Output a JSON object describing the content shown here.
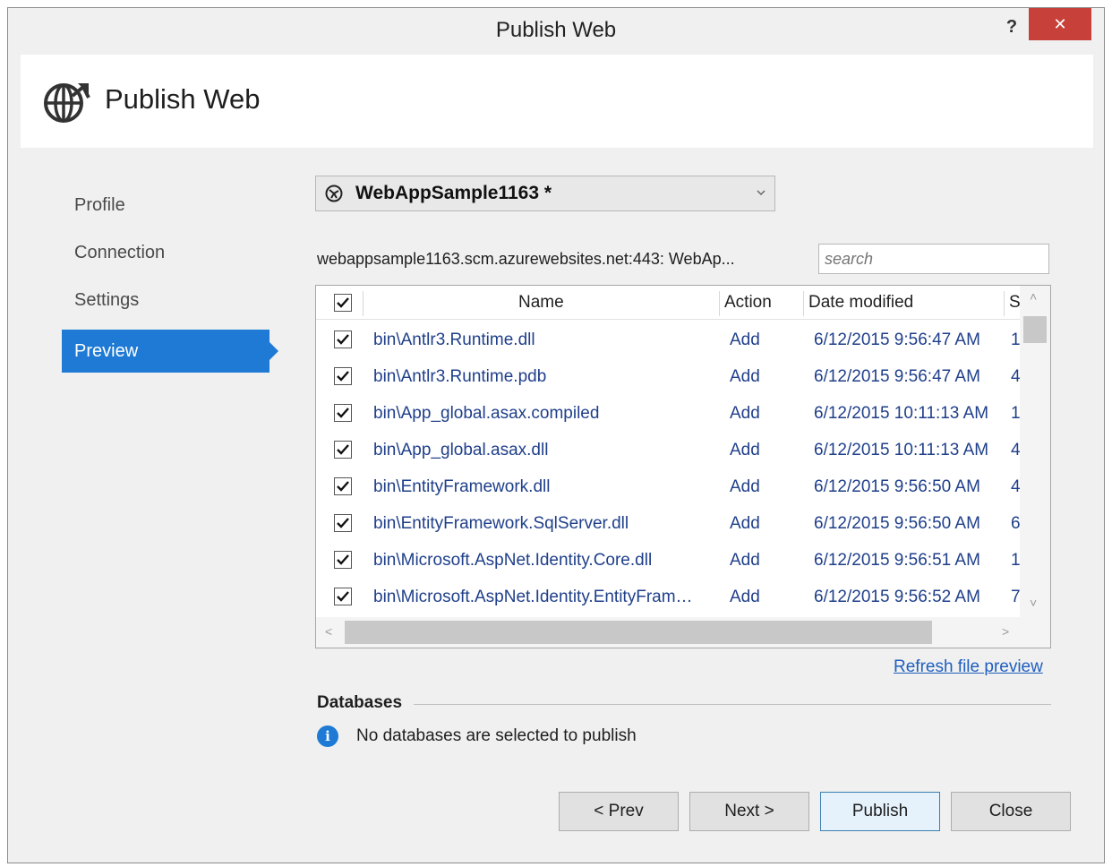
{
  "window": {
    "title": "Publish Web",
    "help_label": "?",
    "close_label": "✕"
  },
  "header": {
    "title": "Publish Web",
    "icon": "globe-publish-icon"
  },
  "sidebar": {
    "items": [
      {
        "label": "Profile",
        "active": false
      },
      {
        "label": "Connection",
        "active": false
      },
      {
        "label": "Settings",
        "active": false
      },
      {
        "label": "Preview",
        "active": true
      }
    ]
  },
  "profile": {
    "selected": "WebAppSample1163 *",
    "icon": "azure-site-icon"
  },
  "server_label": "webappsample1163.scm.azurewebsites.net:443: WebAp...",
  "search": {
    "placeholder": "search",
    "value": ""
  },
  "grid": {
    "columns": [
      "Name",
      "Action",
      "Date modified",
      "S"
    ],
    "select_all": true,
    "rows": [
      {
        "checked": true,
        "name": "bin\\Antlr3.Runtime.dll",
        "action": "Add",
        "date": "6/12/2015 9:56:47 AM",
        "size": "1"
      },
      {
        "checked": true,
        "name": "bin\\Antlr3.Runtime.pdb",
        "action": "Add",
        "date": "6/12/2015 9:56:47 AM",
        "size": "4"
      },
      {
        "checked": true,
        "name": "bin\\App_global.asax.compiled",
        "action": "Add",
        "date": "6/12/2015 10:11:13 AM",
        "size": "1"
      },
      {
        "checked": true,
        "name": "bin\\App_global.asax.dll",
        "action": "Add",
        "date": "6/12/2015 10:11:13 AM",
        "size": "4"
      },
      {
        "checked": true,
        "name": "bin\\EntityFramework.dll",
        "action": "Add",
        "date": "6/12/2015 9:56:50 AM",
        "size": "4"
      },
      {
        "checked": true,
        "name": "bin\\EntityFramework.SqlServer.dll",
        "action": "Add",
        "date": "6/12/2015 9:56:50 AM",
        "size": "6"
      },
      {
        "checked": true,
        "name": "bin\\Microsoft.AspNet.Identity.Core.dll",
        "action": "Add",
        "date": "6/12/2015 9:56:51 AM",
        "size": "1"
      },
      {
        "checked": true,
        "name": "bin\\Microsoft.AspNet.Identity.EntityFram…",
        "action": "Add",
        "date": "6/12/2015 9:56:52 AM",
        "size": "7"
      }
    ]
  },
  "refresh_link": "Refresh file preview",
  "databases": {
    "label": "Databases",
    "message": "No databases are selected to publish",
    "icon": "info-icon"
  },
  "buttons": {
    "prev": "< Prev",
    "next": "Next >",
    "publish": "Publish",
    "close": "Close"
  },
  "colors": {
    "accent": "#1e7ad4",
    "close_button": "#c7403a",
    "link": "#1f5fbf"
  }
}
